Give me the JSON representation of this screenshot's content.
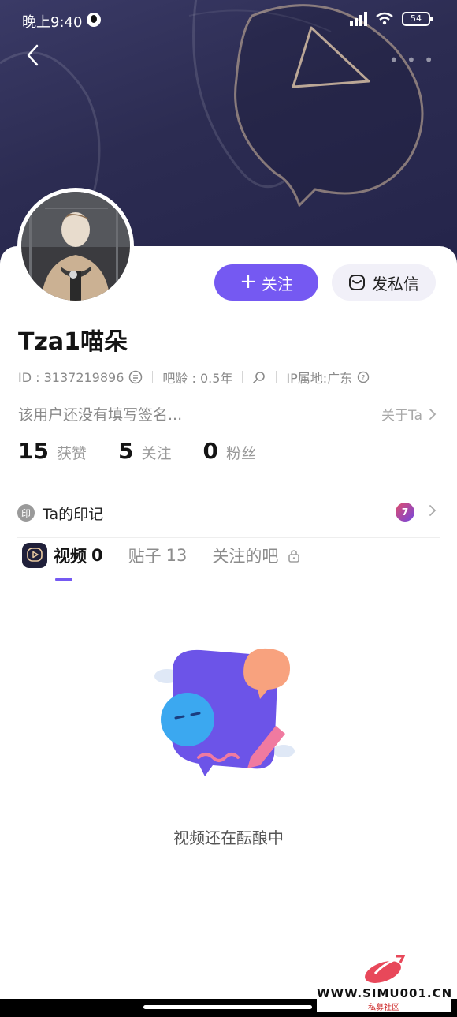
{
  "status_bar": {
    "time": "晚上9:40",
    "battery": "54"
  },
  "profile": {
    "username": "Tza1喵朵",
    "id_text": "ID : 3137219896",
    "age_text": "吧龄 : 0.5年",
    "ip_text": "IP属地:广东",
    "signature": "该用户还没有填写签名...",
    "about_label": "关于Ta"
  },
  "actions": {
    "follow_label": "关注",
    "message_label": "发私信"
  },
  "stats": [
    {
      "num": "15",
      "label": "获赞"
    },
    {
      "num": "5",
      "label": "关注"
    },
    {
      "num": "0",
      "label": "粉丝"
    }
  ],
  "imprint": {
    "seal": "印",
    "label": "Ta的印记",
    "badge": "7"
  },
  "tabs": [
    {
      "label": "视频",
      "count": "0"
    },
    {
      "label": "贴子",
      "count": "13"
    },
    {
      "label": "关注的吧",
      "count": ""
    }
  ],
  "empty_state": {
    "text": "视频还在酝酿中"
  },
  "watermark": {
    "site": "WWW.SIMU001.CN",
    "sub": "私募社区"
  },
  "colors": {
    "accent": "#7559f2",
    "banner": "#2c2c52"
  }
}
